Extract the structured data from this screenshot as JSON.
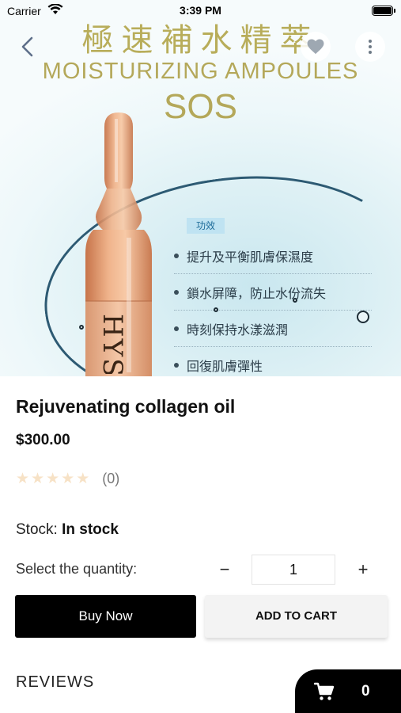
{
  "status_bar": {
    "carrier": "Carrier",
    "time": "3:39 PM"
  },
  "nav": {
    "back_icon": "chevron-left-icon",
    "favorite_icon": "heart-icon",
    "more_icon": "vertical-dots-icon"
  },
  "hero": {
    "title_cn": "極速補水精萃",
    "title_en": "MOISTURIZING AMPOULES",
    "title_sos": "SOS",
    "badge": "功效",
    "benefits": [
      "提升及平衡肌膚保濕度",
      "鎖水屏障，防止水份流失",
      "時刻保持水漾滋潤",
      "回復肌膚彈性"
    ],
    "ampoule_text": "HYS",
    "colors": {
      "gold": "#b4a85a",
      "ampoule": "#e8a47a"
    }
  },
  "product": {
    "name": "Rejuvenating collagen oil",
    "price": "$300.00",
    "rating": 0,
    "rating_max": 5,
    "rating_count": "(0)",
    "stock_label": "Stock:",
    "stock_value": "In stock",
    "quantity_label": "Select the quantity:",
    "quantity_value": "1",
    "minus": "−",
    "plus": "+"
  },
  "actions": {
    "buy_now": "Buy Now",
    "add_to_cart": "ADD TO CART"
  },
  "reviews": {
    "heading": "REVIEWS"
  },
  "cart": {
    "icon": "cart-icon",
    "count": "0"
  }
}
